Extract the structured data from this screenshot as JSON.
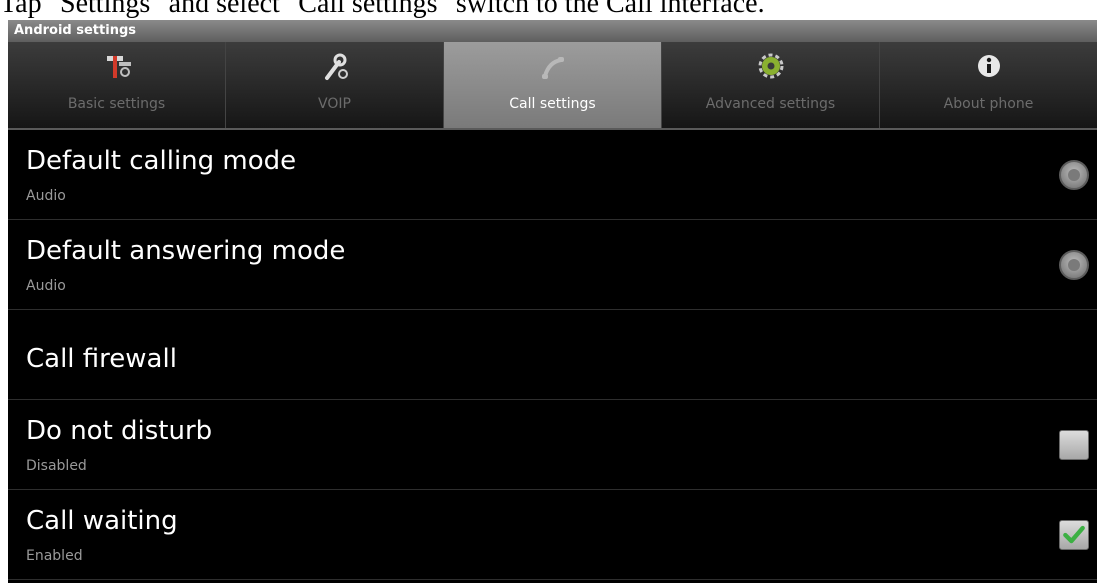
{
  "caption": "Tap \"Settings\" and select \"Call settings\" switch to the Call interface.",
  "window_title": "Android settings",
  "tabs": [
    {
      "label": "Basic settings",
      "icon": "tools-icon"
    },
    {
      "label": "VOIP",
      "icon": "wrench-icon"
    },
    {
      "label": "Call settings",
      "icon": "phone-handset-icon",
      "active": true
    },
    {
      "label": "Advanced settings",
      "icon": "gear-icon"
    },
    {
      "label": "About phone",
      "icon": "info-icon"
    }
  ],
  "settings": [
    {
      "title": "Default calling mode",
      "summary": "Audio",
      "control": "radio"
    },
    {
      "title": "Default answering mode",
      "summary": "Audio",
      "control": "radio"
    },
    {
      "title": "Call firewall",
      "summary": "",
      "control": "none"
    },
    {
      "title": "Do not disturb",
      "summary": "Disabled",
      "control": "checkbox",
      "checked": false
    },
    {
      "title": "Call waiting",
      "summary": "Enabled",
      "control": "checkbox",
      "checked": true
    }
  ],
  "colors": {
    "check_accent": "#3cb043",
    "active_tab": "#8a8a8a",
    "background": "#000000"
  }
}
